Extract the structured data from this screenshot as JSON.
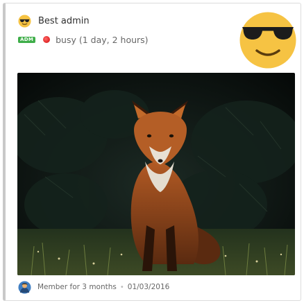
{
  "profile": {
    "name": "Best admin",
    "role_badge": "ADM",
    "status": "busy (1 day, 2 hours)",
    "status_color": "#e32b2b"
  },
  "avatar": {
    "icon": "sunglasses-smiley-icon",
    "color": "#f6c343"
  },
  "post_image": {
    "subject": "fox-photo"
  },
  "footer": {
    "membership": "Member for 3 months",
    "separator": "•",
    "date": "01/03/2016",
    "avatar_icon": "user-avatar-icon"
  }
}
